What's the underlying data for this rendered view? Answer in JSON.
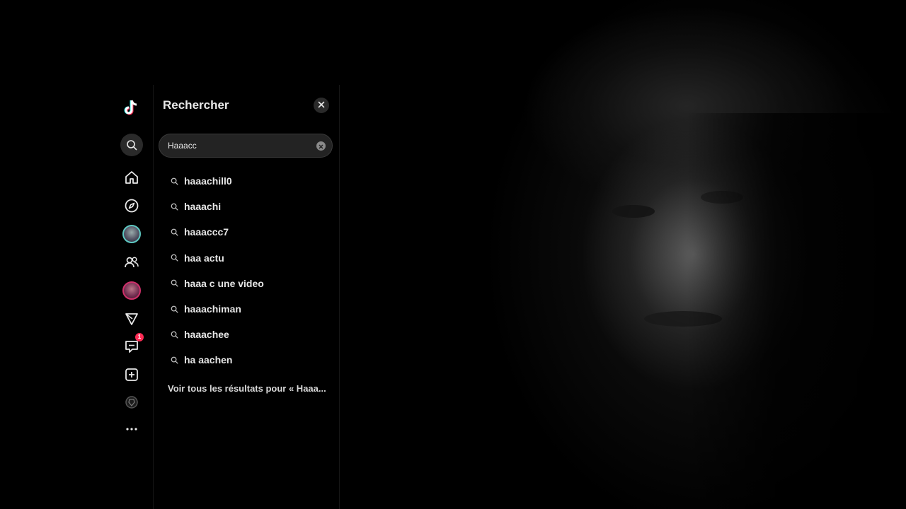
{
  "panel": {
    "title": "Rechercher",
    "search": {
      "value": "Haaacc",
      "placeholder": "Rechercher"
    },
    "suggestions": [
      "haaachill0",
      "haaachi",
      "haaaccc7",
      "haa actu",
      "haaa c une video",
      "haaachiman",
      "haaachee",
      "ha aachen"
    ],
    "see_all": "Voir tous les résultats pour « Haaa..."
  },
  "rail": {
    "items": [
      {
        "icon": "tiktok-logo-icon"
      },
      {
        "icon": "search-icon"
      },
      {
        "icon": "home-icon"
      },
      {
        "icon": "explore-compass-icon"
      },
      {
        "icon": "following-avatar-icon"
      },
      {
        "icon": "friends-icon"
      },
      {
        "icon": "live-avatar-icon"
      },
      {
        "icon": "send-icon"
      },
      {
        "icon": "messages-icon"
      },
      {
        "icon": "upload-icon"
      },
      {
        "icon": "profile-icon"
      },
      {
        "icon": "more-icon"
      }
    ],
    "messages_badge": "1"
  },
  "colors": {
    "background": "#000000",
    "panel": "#000000",
    "search_box": "#232323",
    "badge": "#fe2c55",
    "avatar_ring_teal": "#5ec8c2",
    "avatar_ring_pink": "#d0306a"
  }
}
